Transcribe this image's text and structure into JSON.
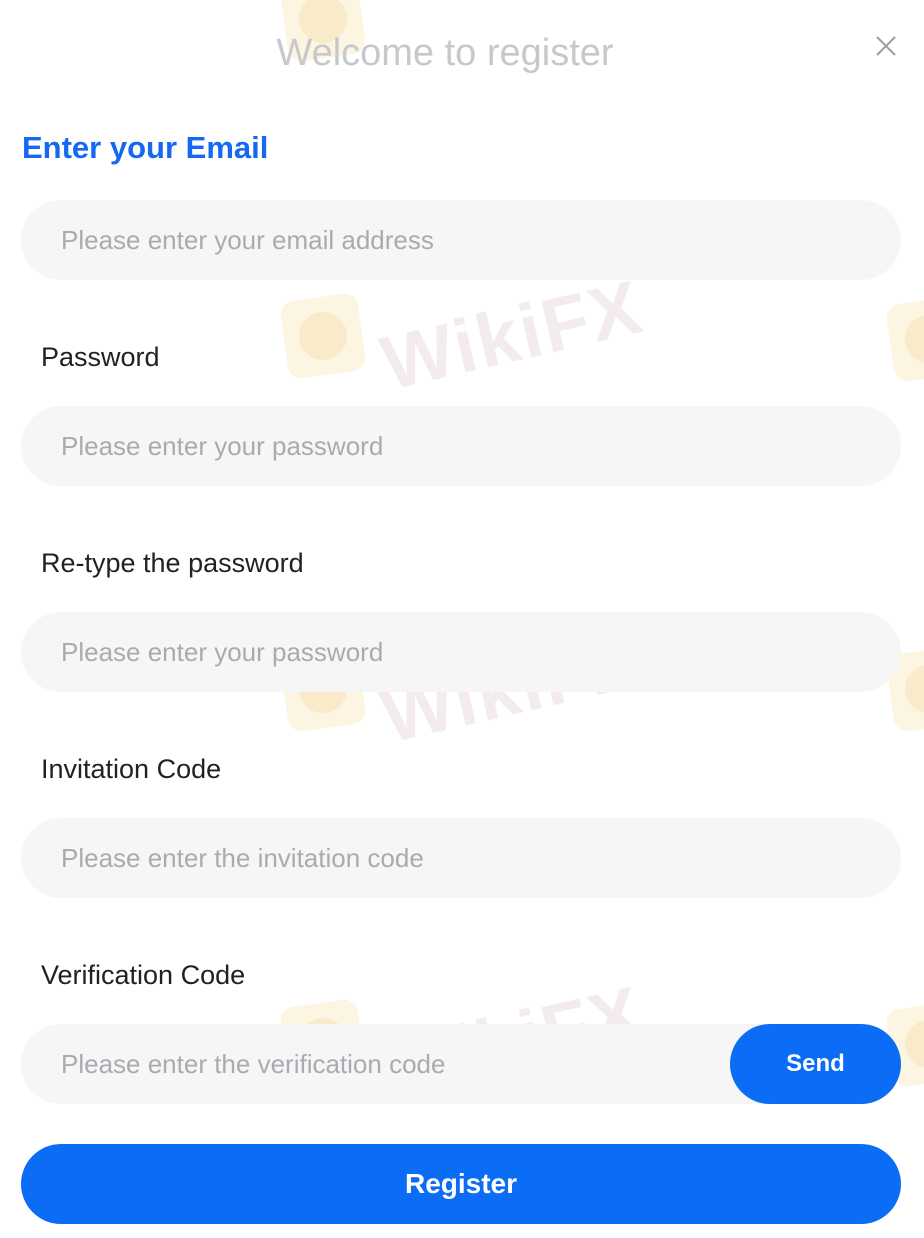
{
  "dialog": {
    "title": "Welcome to register",
    "close_icon": "close-icon"
  },
  "email": {
    "heading": "Enter your Email",
    "placeholder": "Please enter your email address"
  },
  "password": {
    "label": "Password",
    "placeholder": "Please enter your password"
  },
  "retype_password": {
    "label": "Re-type the password",
    "placeholder": "Please enter your password"
  },
  "invitation": {
    "label": "Invitation Code",
    "placeholder": "Please enter the invitation code"
  },
  "verification": {
    "label": "Verification Code",
    "placeholder": "Please enter the verification code",
    "send_label": "Send"
  },
  "register_label": "Register",
  "watermark": {
    "text": "WikiFX",
    "icon": "wikifx-logo-icon"
  },
  "colors": {
    "accent": "#0b6cf5",
    "heading": "#1468f2",
    "field_bg": "#f6f6f7"
  }
}
